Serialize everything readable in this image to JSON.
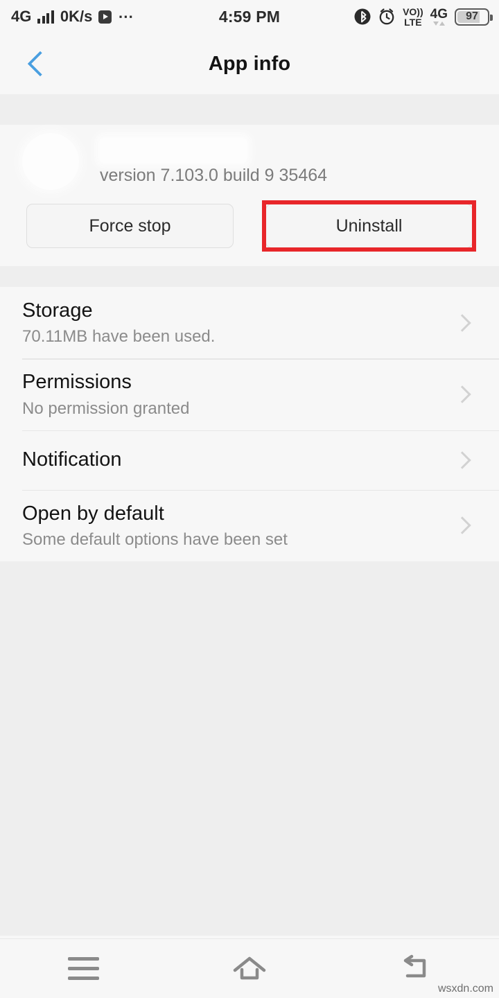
{
  "statusbar": {
    "network_type": "4G",
    "data_rate": "0K/s",
    "play_icon": "play-icon",
    "overflow_icon": "more-dots-icon",
    "time": "4:59 PM",
    "bluetooth_icon": "bluetooth-icon",
    "alarm_icon": "alarm-clock-icon",
    "volte_top": "VO))",
    "volte_bottom": "LTE",
    "mobile_network": "4G",
    "battery_percent": "97"
  },
  "header": {
    "back_icon": "back-chevron-icon",
    "title": "App info"
  },
  "app": {
    "name": "",
    "version": "version 7.103.0 build 9 35464"
  },
  "actions": {
    "force_stop": "Force stop",
    "uninstall": "Uninstall",
    "highlight_color": "#e8262a"
  },
  "list": [
    {
      "title": "Storage",
      "sub": "70.11MB have been used."
    },
    {
      "title": "Permissions",
      "sub": "No permission granted"
    },
    {
      "title": "Notification",
      "sub": ""
    },
    {
      "title": "Open by default",
      "sub": "Some default options have been set"
    }
  ],
  "navbar": {
    "menu_icon": "menu-icon",
    "home_icon": "home-icon",
    "back_icon": "back-arrow-icon"
  },
  "watermark": "wsxdn.com"
}
